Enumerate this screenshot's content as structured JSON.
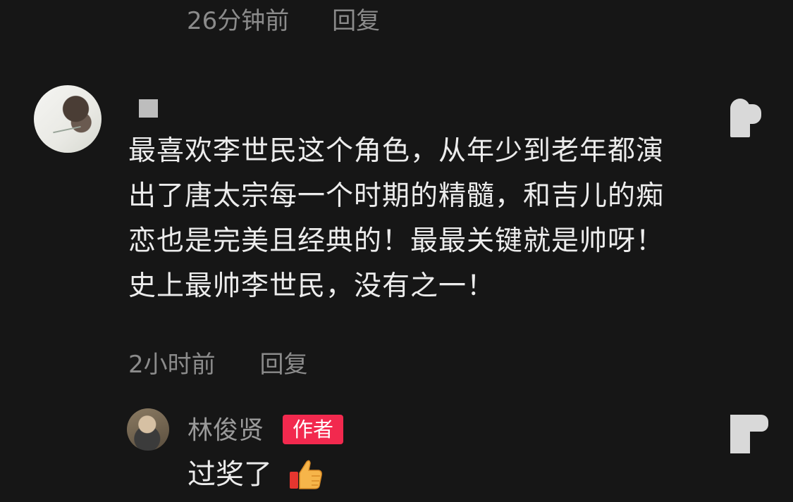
{
  "top_item": {
    "time": "26分钟前",
    "reply_label": "回复"
  },
  "comment": {
    "text": "最喜欢李世民这个角色，从年少到老年都演出了唐太宗每一个时期的精髓，和吉儿的痴恋也是完美且经典的！最最关键就是帅呀！史上最帅李世民，没有之一！",
    "time": "2小时前",
    "reply_label": "回复"
  },
  "author_reply": {
    "name": "林俊贤",
    "badge": "作者",
    "text": "过奖了",
    "emoji": "thumbs-up-icon"
  },
  "colors": {
    "background": "#161616",
    "meta_text": "#8b8b8b",
    "body_text": "#ececec",
    "badge": "#f2294e"
  }
}
